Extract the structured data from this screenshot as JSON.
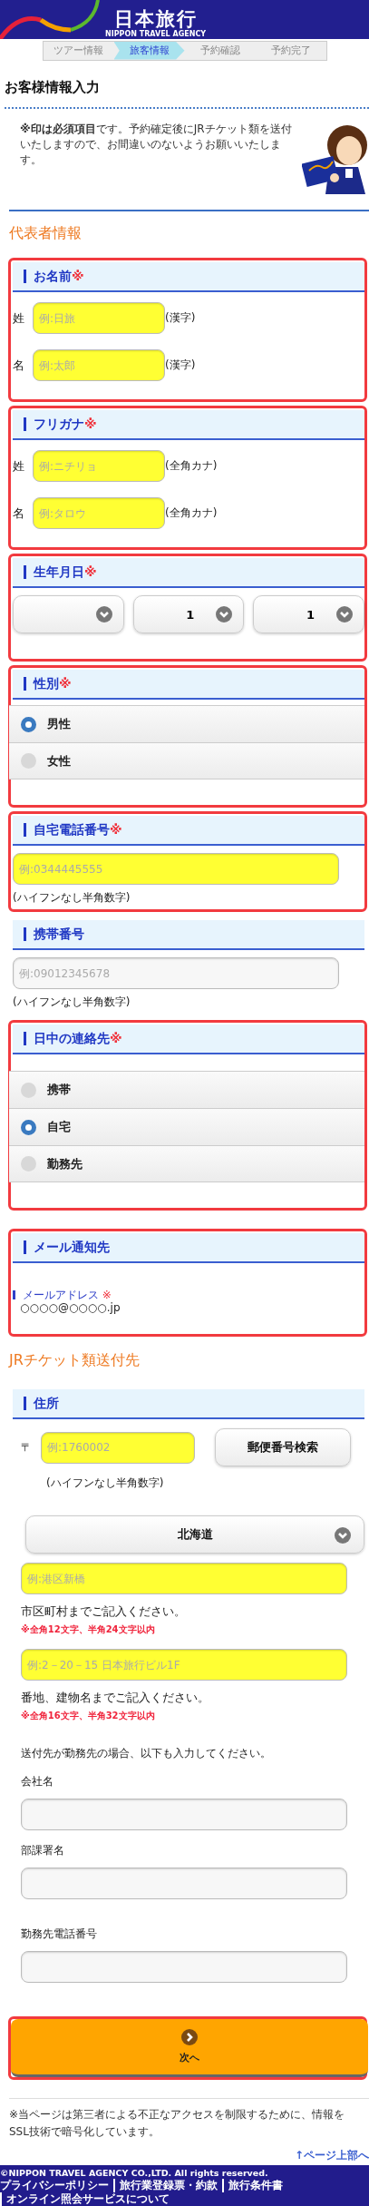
{
  "header": {
    "logo_text": "日本旅行",
    "logo_subtext": "NIPPON TRAVEL AGENCY"
  },
  "steps": [
    {
      "label": "ツアー情報",
      "selected": false
    },
    {
      "label": "旅客情報",
      "selected": true
    },
    {
      "label": "予約確認",
      "selected": false
    },
    {
      "label": "予約完了",
      "selected": false
    }
  ],
  "page_title": "お客様情報入力",
  "notice": "**※印は必須項目**です。予約確定後にJRチケット類を送付いたしますので、お間違いのないようお願いいたします。",
  "blocks": [
    {
      "kind": "heading",
      "text": "代表者情報"
    },
    {
      "kind": "names",
      "title": "お名前",
      "mark": "※",
      "highlighted": true,
      "rows": [
        {
          "label": "姓",
          "placeholder": "例:日旅",
          "required": true,
          "note": "(漢字)"
        },
        {
          "label": "名",
          "placeholder": "例:太郎",
          "required": true,
          "note": "(漢字)"
        }
      ]
    },
    {
      "kind": "names",
      "title": "フリガナ",
      "mark": "※",
      "highlighted": true,
      "rows": [
        {
          "label": "姓",
          "placeholder": "例:ニチリョ",
          "required": true,
          "note": "(全角カナ)"
        },
        {
          "label": "名",
          "placeholder": "例:タロウ",
          "required": true,
          "note": "(全角カナ)"
        }
      ]
    },
    {
      "kind": "selects",
      "title": "生年月日",
      "mark": "※",
      "highlighted": true,
      "selects": [
        {
          "kind": "empty"
        },
        {
          "kind": "filled",
          "value": "1"
        },
        {
          "kind": "filled",
          "value": "1"
        }
      ]
    },
    {
      "kind": "radios",
      "title": "性別",
      "mark": "※",
      "highlighted": true,
      "options": [
        {
          "label": "男性",
          "selected": true
        },
        {
          "label": "女性",
          "selected": false
        }
      ]
    },
    {
      "kind": "phone",
      "title": "自宅電話番号",
      "mark": "※",
      "highlighted": true,
      "placeholder": "例:0344445555",
      "required": true,
      "hint": "(ハイフンなし半角数字)"
    },
    {
      "kind": "phone",
      "title": "携帯番号",
      "highlighted": false,
      "placeholder": "例:09012345678",
      "required": false,
      "hint": "(ハイフンなし半角数字)"
    },
    {
      "kind": "radios",
      "title": "日中の連絡先",
      "mark": "※",
      "highlighted": true,
      "options": [
        {
          "label": "携帯",
          "selected": false
        },
        {
          "label": "自宅",
          "selected": true
        },
        {
          "label": "勤務先",
          "selected": false
        }
      ]
    },
    {
      "kind": "email",
      "title": "メール通知先",
      "highlighted": true,
      "label": "メールアドレス",
      "label_mark": "※",
      "value": "○○○○@○○○○.jp"
    },
    {
      "kind": "heading",
      "text": "JRチケット類送付先"
    },
    {
      "kind": "address",
      "title": "住所",
      "highlighted": false,
      "postal": {
        "prefix": "〒",
        "placeholder": "例:1760002",
        "required": true,
        "button": "郵便番号検索",
        "hint": "(ハイフンなし半角数字)"
      },
      "prefecture": "北海道",
      "lines": [
        {
          "placeholder": "例:港区新橋",
          "required": true,
          "hint": "市区町村までご記入ください。",
          "limit": "※全角12文字、半角24文字以内"
        },
        {
          "placeholder": "例:2－20－15 日本旅行ビル1F",
          "required": true,
          "hint": "番地、建物名までご記入ください。",
          "limit": "※全角16文字、半角32文字以内"
        }
      ],
      "note": "送付先が勤務先の場合、以下も入力してください。",
      "extra_fields": [
        {
          "label": "会社名"
        },
        {
          "label": "部課署名"
        },
        {
          "label": "勤務先電話番号"
        }
      ]
    },
    {
      "kind": "submit",
      "label": "次へ",
      "highlighted": true
    }
  ],
  "security_note": "※当ページは第三者による不正なアクセスを制限するために、情報をSSL技術で暗号化しています。",
  "page_top_link": "↑ページ上部へ",
  "footer": {
    "copyright": "©NIPPON TRAVEL AGENCY CO.,LTD. All rights reserved.",
    "links": [
      "プライバシーポリシー",
      "旅行業登録票・約款",
      "旅行条件書",
      "オンライン照会サービスについて"
    ]
  }
}
